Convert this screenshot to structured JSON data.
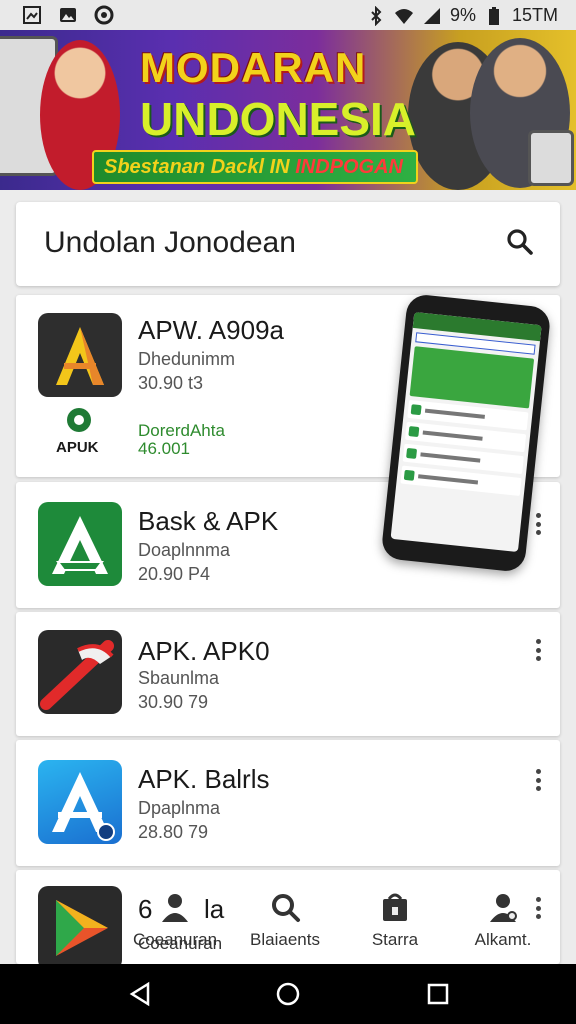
{
  "status_bar": {
    "battery": "9%",
    "time": "15TM"
  },
  "banner": {
    "title_line1": "MODARAN",
    "title_line2": "UNDONESIA",
    "ribbon_text_a": "Sbestanan Dackl IN",
    "ribbon_text_b": "INDPOGAN"
  },
  "search": {
    "query": "Undolan Jonodean"
  },
  "apps": [
    {
      "name": "APW. A909a",
      "developer": "Dhedunimm",
      "size": "30.90 t3",
      "badge_label": "APUK",
      "extra_line1": "DorerdAhta",
      "extra_line2": "46.001"
    },
    {
      "name": "Bask & APK",
      "developer": "Doaplnnma",
      "size": "20.90 P4"
    },
    {
      "name": "APK. APK0",
      "developer": "Sbaunlma",
      "size": "30.90 79"
    },
    {
      "name": "APK. Balrls",
      "developer": "Dpaplnma",
      "size": "28.80 79"
    },
    {
      "name": "6",
      "name_tail": "la",
      "developer": "Coeanuran"
    }
  ],
  "bottom_nav": [
    {
      "label": "Coeanuran",
      "icon": "person-icon"
    },
    {
      "label": "Blaiaents",
      "icon": "search-icon"
    },
    {
      "label": "Starra",
      "icon": "store-icon"
    },
    {
      "label": "Alkamt.",
      "icon": "account-icon"
    }
  ],
  "colors": {
    "accent_green": "#2e8b2e",
    "card_bg": "#ffffff",
    "page_bg": "#ececec"
  }
}
